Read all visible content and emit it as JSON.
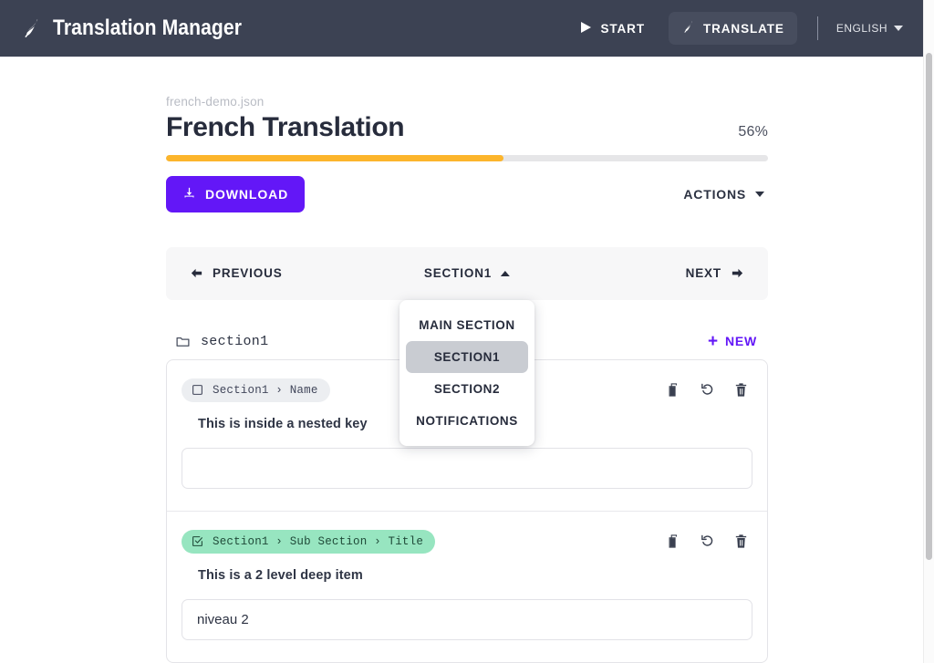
{
  "appbar": {
    "brand_icon": "feather-icon",
    "brand_title": "Translation Manager",
    "start_label": "START",
    "start_icon": "play-icon",
    "translate_label": "TRANSLATE",
    "translate_icon": "feather-icon",
    "language_label": "ENGLISH",
    "language_caret_icon": "chevron-down-icon",
    "background_color": "#3c4253"
  },
  "document": {
    "filename": "french-demo.json",
    "title": "French Translation",
    "progress_percent_label": "56%",
    "progress_percent": 56,
    "progress_fill_color": "#fcb52c",
    "download_label": "DOWNLOAD",
    "download_icon": "download-icon",
    "download_color": "#6317f7",
    "actions_label": "ACTIONS",
    "actions_caret_icon": "chevron-down-icon"
  },
  "section_nav": {
    "previous_label": "PREVIOUS",
    "previous_icon": "arrow-left-icon",
    "current_section_label": "SECTION1",
    "current_section_caret_icon": "chevron-up-icon",
    "next_label": "NEXT",
    "next_icon": "arrow-right-icon",
    "dropdown_open": true,
    "dropdown_items": [
      {
        "label": "MAIN SECTION",
        "selected": false
      },
      {
        "label": "SECTION1",
        "selected": true
      },
      {
        "label": "SECTION2",
        "selected": false
      },
      {
        "label": "NOTIFICATIONS",
        "selected": false
      }
    ]
  },
  "folder": {
    "icon": "folder-icon",
    "name": "section1",
    "new_label": "NEW",
    "new_plus_icon": "plus-icon",
    "new_color": "#6317f7"
  },
  "entries": [
    {
      "key_path": "Section1 › Name",
      "checkbox_icon": "checkbox-unchecked-icon",
      "checked": false,
      "badge_style": "gray",
      "source_text": "This is inside a nested key",
      "translation_value": "",
      "translation_placeholder": "",
      "copy_icon": "copy-icon",
      "revert_icon": "undo-icon",
      "delete_icon": "trash-icon"
    },
    {
      "key_path": "Section1 › Sub Section › Title",
      "checkbox_icon": "checkbox-checked-icon",
      "checked": true,
      "badge_style": "green",
      "source_text": "This is a 2 level deep item",
      "translation_value": "niveau 2",
      "translation_placeholder": "",
      "copy_icon": "copy-icon",
      "revert_icon": "undo-icon",
      "delete_icon": "trash-icon"
    }
  ],
  "scrollbar": {
    "icon": "vertical-scrollbar"
  }
}
